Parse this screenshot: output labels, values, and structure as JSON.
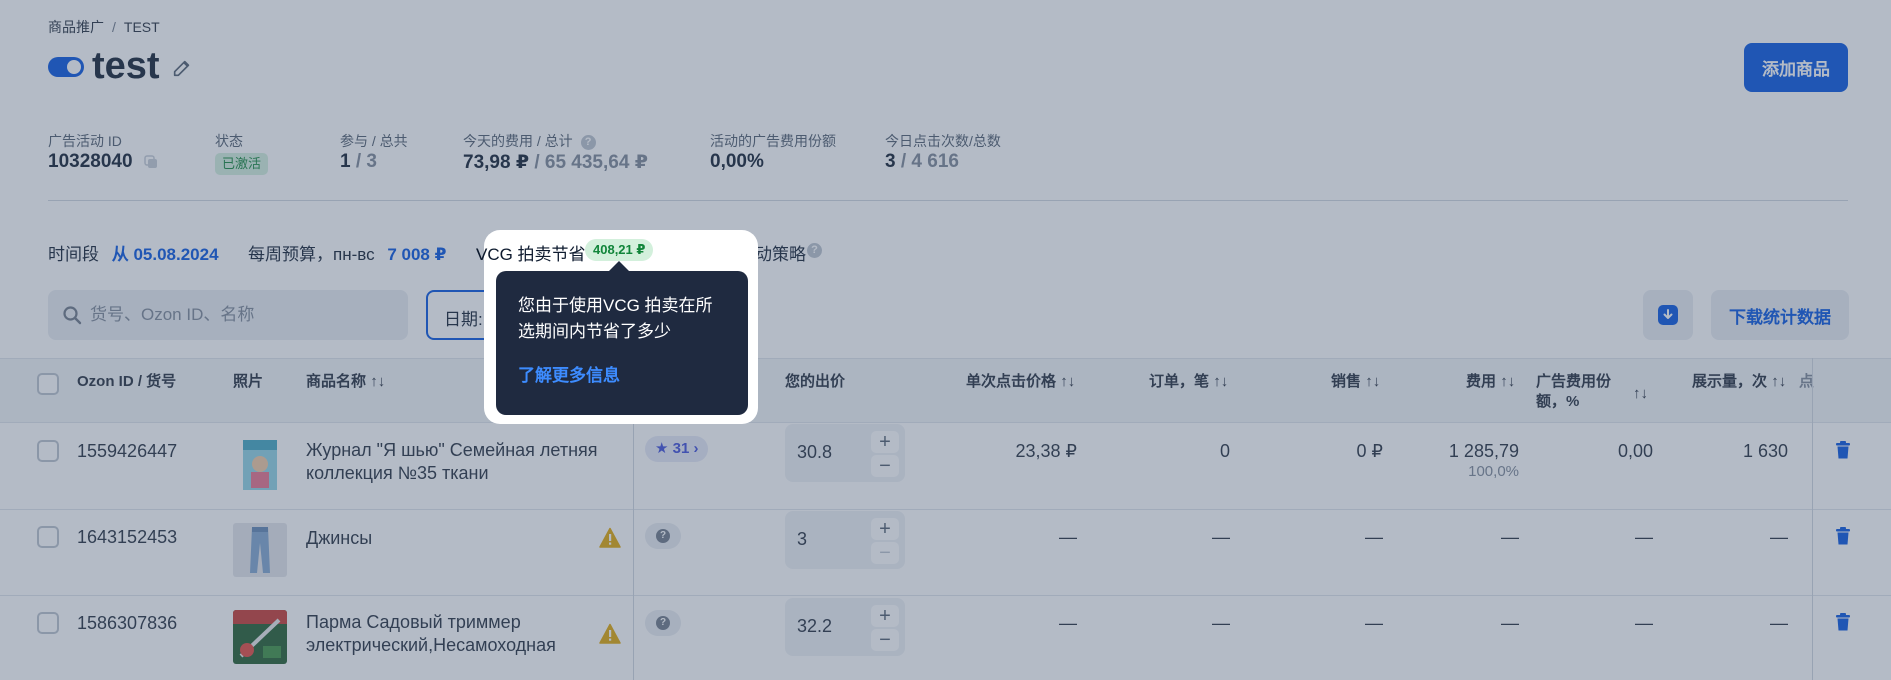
{
  "breadcrumb": {
    "parent": "商品推广",
    "separator": "/",
    "current": "TEST"
  },
  "campaign": {
    "title": "test",
    "add_button": "添加商品"
  },
  "stats": {
    "id_label": "广告活动 ID",
    "id_value": "10328040",
    "status_label": "状态",
    "status_value": "已激活",
    "participating_label": "参与 / 总共",
    "participating_value": "1",
    "participating_total": "/ 3",
    "cost_label": "今天的费用 / 总计",
    "cost_value": "73,98 ₽",
    "cost_total": "/ 65 435,64 ₽",
    "ad_share_label": "活动的广告费用份额",
    "ad_share_value": "0,00%",
    "clicks_label": "今日点击次数/总数",
    "clicks_value": "3",
    "clicks_total": "/ 4 616"
  },
  "period": {
    "label": "时间段",
    "value": "从 05.08.2024",
    "budget_label": "每周预算，пн-вс",
    "budget_value": "7 008 ₽",
    "vcg_label": "VCG 拍卖节省",
    "vcg_value": "408,21 ₽",
    "auto_label": "自动策略"
  },
  "toolbar": {
    "search_placeholder": "货号、Ozon ID、名称",
    "date_label": "日期: 7",
    "download_label": "下载统计数据"
  },
  "table": {
    "columns": {
      "id": "Ozon ID / 货号",
      "photo": "照片",
      "name": "商品名称",
      "bid": "您的出价",
      "cpc": "单次点击价格",
      "orders": "订单，笔",
      "sales": "销售",
      "cost": "费用",
      "share": "广告费用份额，%",
      "impressions": "展示量，次",
      "more": "点"
    },
    "rows": [
      {
        "id": "1559426447",
        "name": "Журнал \"Я шью\" Семейная летняя коллекция №35 ткани",
        "rating": "31",
        "bid": "30.8",
        "cpc": "23,38 ₽",
        "orders": "0",
        "sales": "0 ₽",
        "cost": "1 285,79",
        "cost_sub": "100,0%",
        "share": "0,00",
        "impressions": "1 630"
      },
      {
        "id": "1643152453",
        "name": "Джинсы",
        "bid": "3",
        "cpc": "—",
        "orders": "—",
        "sales": "—",
        "cost": "—",
        "share": "—",
        "impressions": "—"
      },
      {
        "id": "1586307836",
        "name": "Парма Садовый триммер электрический,Несамоходная",
        "bid": "32.2",
        "cpc": "—",
        "orders": "—",
        "sales": "—",
        "cost": "—",
        "share": "—",
        "impressions": "—"
      }
    ]
  },
  "tooltip": {
    "text": "您由于使用VCG 拍卖在所选期间内节省了多少",
    "link": "了解更多信息"
  },
  "colors": {
    "accent": "#0052e0",
    "success": "#11853a",
    "tooltip_bg": "#1f2a40",
    "link": "#3d8cff",
    "warning": "#e0a500"
  }
}
